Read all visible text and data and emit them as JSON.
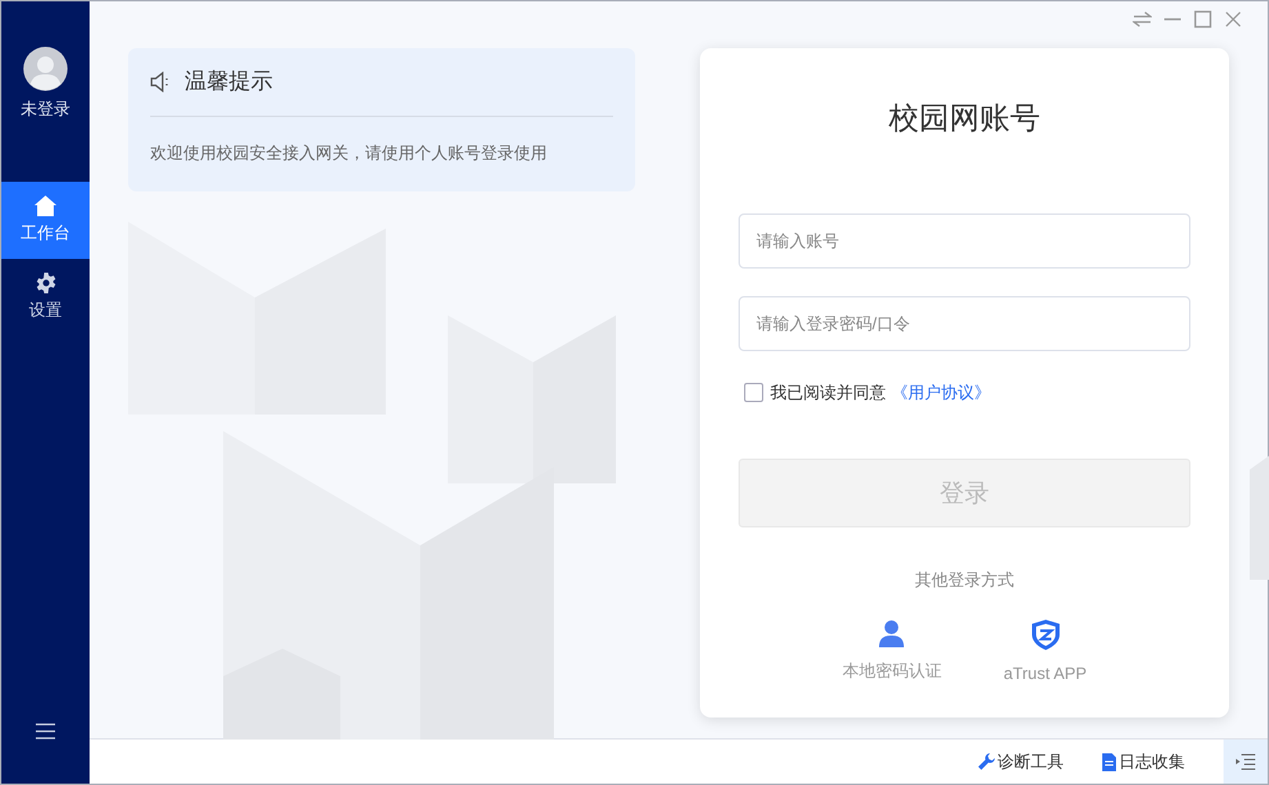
{
  "sidebar": {
    "user": {
      "label": "未登录"
    },
    "items": [
      {
        "label": "工作台",
        "kind": "home",
        "selected": true
      },
      {
        "label": "设置",
        "kind": "settings",
        "selected": false
      }
    ]
  },
  "notice": {
    "title": "温馨提示",
    "message": "欢迎使用校园安全接入网关，请使用个人账号登录使用"
  },
  "login": {
    "title": "校园网账号",
    "fields": [
      {
        "placeholder": "请输入账号"
      },
      {
        "placeholder": "请输入登录密码/口令"
      }
    ],
    "agreement": {
      "label": "我已阅读并同意",
      "link": "《用户协议》",
      "checked": false
    },
    "button": {
      "label": "登录",
      "disabled": true
    },
    "other_label": "其他登录方式",
    "methods": [
      {
        "label": "本地密码认证",
        "kind": "user"
      },
      {
        "label": "aTrust APP",
        "kind": "shield"
      }
    ]
  },
  "footer": {
    "tools": [
      {
        "label": "诊断工具",
        "kind": "wrench"
      },
      {
        "label": "日志收集",
        "kind": "doc"
      }
    ]
  }
}
